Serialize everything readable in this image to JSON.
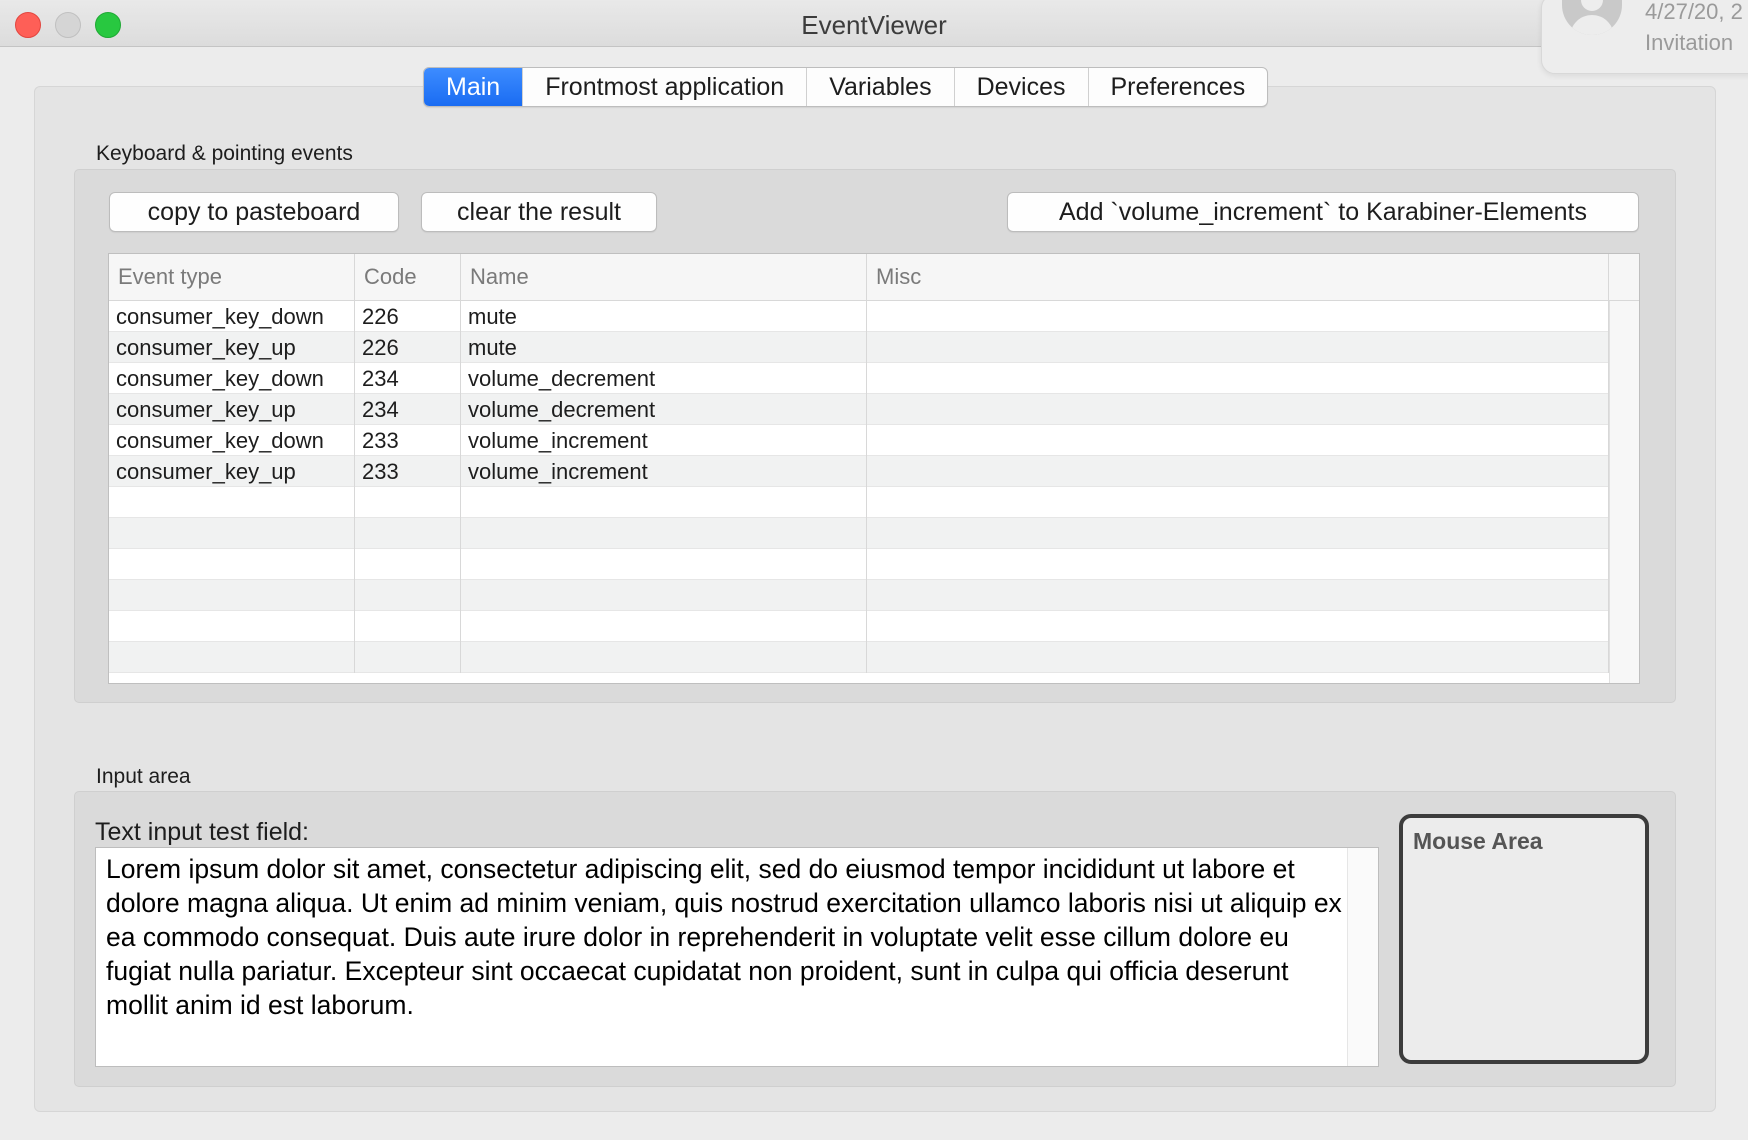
{
  "window": {
    "title": "EventViewer"
  },
  "notification": {
    "date": "4/27/20, 2",
    "text": "Invitation"
  },
  "tabs": [
    {
      "label": "Main",
      "active": true
    },
    {
      "label": "Frontmost application",
      "active": false
    },
    {
      "label": "Variables",
      "active": false
    },
    {
      "label": "Devices",
      "active": false
    },
    {
      "label": "Preferences",
      "active": false
    }
  ],
  "events_section": {
    "label": "Keyboard & pointing events",
    "copy_button": "copy to pasteboard",
    "clear_button": "clear the result",
    "add_button": "Add `volume_increment` to Karabiner-Elements"
  },
  "table": {
    "columns": [
      "Event type",
      "Code",
      "Name",
      "Misc"
    ],
    "rows": [
      [
        "consumer_key_down",
        "226",
        "mute",
        ""
      ],
      [
        "consumer_key_up",
        "226",
        "mute",
        ""
      ],
      [
        "consumer_key_down",
        "234",
        "volume_decrement",
        ""
      ],
      [
        "consumer_key_up",
        "234",
        "volume_decrement",
        ""
      ],
      [
        "consumer_key_down",
        "233",
        "volume_increment",
        ""
      ],
      [
        "consumer_key_up",
        "233",
        "volume_increment",
        ""
      ]
    ],
    "empty_rows": 6
  },
  "input_section": {
    "label": "Input area",
    "text_field_label": "Text input test field:",
    "text_field_value": "Lorem ipsum dolor sit amet, consectetur adipiscing elit, sed do eiusmod tempor incididunt ut labore et dolore magna aliqua. Ut enim ad minim veniam, quis nostrud exercitation ullamco laboris nisi ut aliquip ex ea commodo consequat. Duis aute irure dolor in reprehenderit in voluptate velit esse cillum dolore eu fugiat nulla pariatur. Excepteur sint occaecat cupidatat non proident, sunt in culpa qui officia deserunt mollit anim id est laborum.",
    "mouse_area_label": "Mouse Area"
  },
  "colors": {
    "accent": "#1a6cf2",
    "close": "#fe5f57",
    "zoom": "#28c840"
  }
}
